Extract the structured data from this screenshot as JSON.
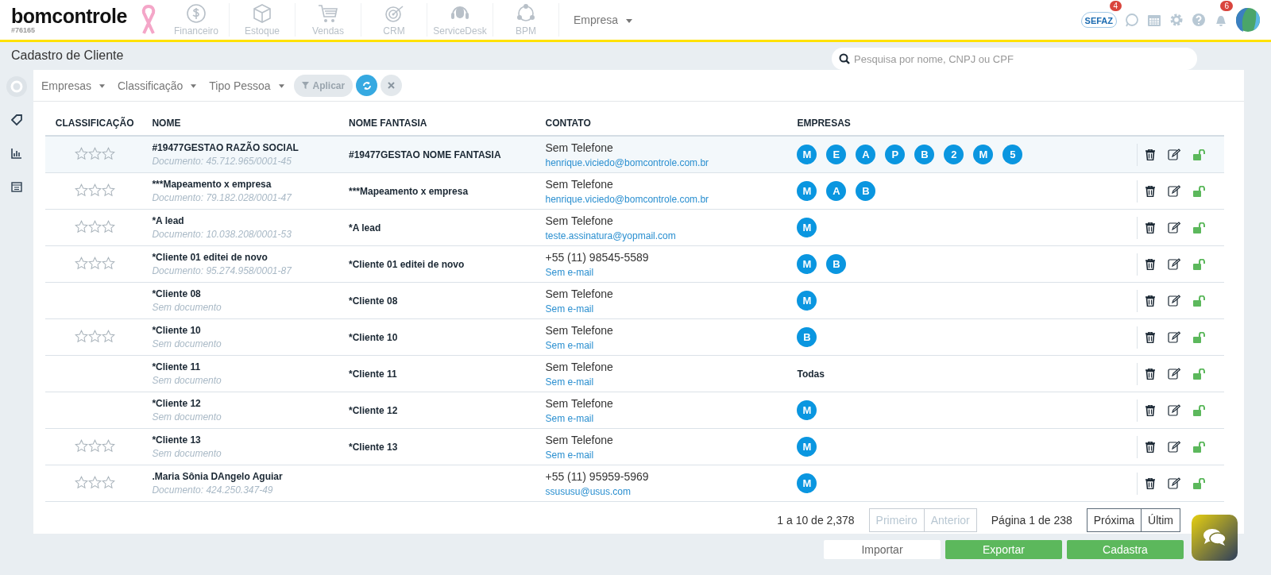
{
  "brand": {
    "logo": "bomcontrole",
    "account": "#76165"
  },
  "modules": [
    {
      "label": "Financeiro",
      "kind": "dollar"
    },
    {
      "label": "Estoque",
      "kind": "box"
    },
    {
      "label": "Vendas",
      "kind": "cart"
    },
    {
      "label": "CRM",
      "kind": "target"
    },
    {
      "label": "ServiceDesk",
      "kind": "headset"
    },
    {
      "label": "BPM",
      "kind": "cycle"
    }
  ],
  "company_menu": "Empresa",
  "top_icons": {
    "sefaz": "SEFAZ",
    "sefaz_badge": "4",
    "notifications_badge": "6"
  },
  "page_title": "Cadastro de Cliente",
  "search": {
    "placeholder": "Pesquisa por nome, CNPJ ou CPF"
  },
  "filters": [
    "Empresas",
    "Classificação",
    "Tipo Pessoa"
  ],
  "apply_button": "Aplicar",
  "table": {
    "columns": [
      "CLASSIFICAÇÃO",
      "NOME",
      "NOME FANTASIA",
      "CONTATO",
      "EMPRESAS"
    ],
    "rows": [
      {
        "selected": true,
        "stars": 0,
        "name": "#19477GESTAO RAZÃO SOCIAL",
        "document": "Documento: 45.712.965/0001-45",
        "fantasia": "#19477GESTAO NOME FANTASIA",
        "phone": "Sem Telefone",
        "email": "henrique.viciedo@bomcontrole.com.br",
        "empresas": [
          "M",
          "E",
          "A",
          "P",
          "B",
          "2",
          "M",
          "5"
        ]
      },
      {
        "selected": false,
        "stars": 0,
        "name": "***Mapeamento x empresa",
        "document": "Documento: 79.182.028/0001-47",
        "fantasia": "***Mapeamento x empresa",
        "phone": "Sem Telefone",
        "email": "henrique.viciedo@bomcontrole.com.br",
        "empresas": [
          "M",
          "A",
          "B"
        ]
      },
      {
        "selected": false,
        "stars": 0,
        "name": "*A lead",
        "document": "Documento: 10.038.208/0001-53",
        "fantasia": "*A lead",
        "phone": "Sem Telefone",
        "email": "teste.assinatura@yopmail.com",
        "empresas": [
          "M"
        ]
      },
      {
        "selected": false,
        "stars": 0,
        "name": "*Cliente 01 editei de novo",
        "document": "Documento: 95.274.958/0001-87",
        "fantasia": "*Cliente 01 editei de novo",
        "phone": "+55 (11) 98545-5589",
        "email": "Sem e-mail",
        "empresas": [
          "M",
          "B"
        ]
      },
      {
        "selected": false,
        "name": "*Cliente 08",
        "document": "Sem documento",
        "fantasia": "*Cliente 08",
        "phone": "Sem Telefone",
        "email": "Sem e-mail",
        "empresas": [
          "M"
        ]
      },
      {
        "selected": false,
        "stars": 0,
        "name": "*Cliente 10",
        "document": "Sem documento",
        "fantasia": "*Cliente 10",
        "phone": "Sem Telefone",
        "email": "Sem e-mail",
        "empresas": [
          "B"
        ]
      },
      {
        "selected": false,
        "name": "*Cliente 11",
        "document": "Sem documento",
        "fantasia": "*Cliente 11",
        "phone": "Sem Telefone",
        "email": "Sem e-mail",
        "empresas_text": "Todas"
      },
      {
        "selected": false,
        "name": "*Cliente 12",
        "document": "Sem documento",
        "fantasia": "*Cliente 12",
        "phone": "Sem Telefone",
        "email": "Sem e-mail",
        "empresas": [
          "M"
        ]
      },
      {
        "selected": false,
        "stars": 0,
        "name": "*Cliente 13",
        "document": "Sem documento",
        "fantasia": "*Cliente 13",
        "phone": "Sem Telefone",
        "email": "Sem e-mail",
        "empresas": [
          "M"
        ]
      },
      {
        "selected": false,
        "stars": 0,
        "name": ".Maria Sônia DAngelo Aguiar",
        "document": "Documento: 424.250.347-49",
        "phone": "+55 (11) 95959-5969",
        "email": "ssususu@usus.com",
        "empresas": [
          "M"
        ]
      }
    ]
  },
  "pagination": {
    "summary": "1 a 10 de 2,378",
    "page": "Página 1 de 238",
    "buttons": [
      {
        "label": "Primeiro",
        "disabled": true
      },
      {
        "label": "Anterior",
        "disabled": true
      }
    ],
    "buttons_right": [
      {
        "label": "Próxima",
        "disabled": false
      },
      {
        "label": "Últim",
        "disabled": false
      }
    ]
  },
  "actions": [
    {
      "label": "Importar",
      "kind": "plain"
    },
    {
      "label": "Exportar",
      "kind": "primary"
    },
    {
      "label": "Cadastra",
      "kind": "primary"
    }
  ]
}
